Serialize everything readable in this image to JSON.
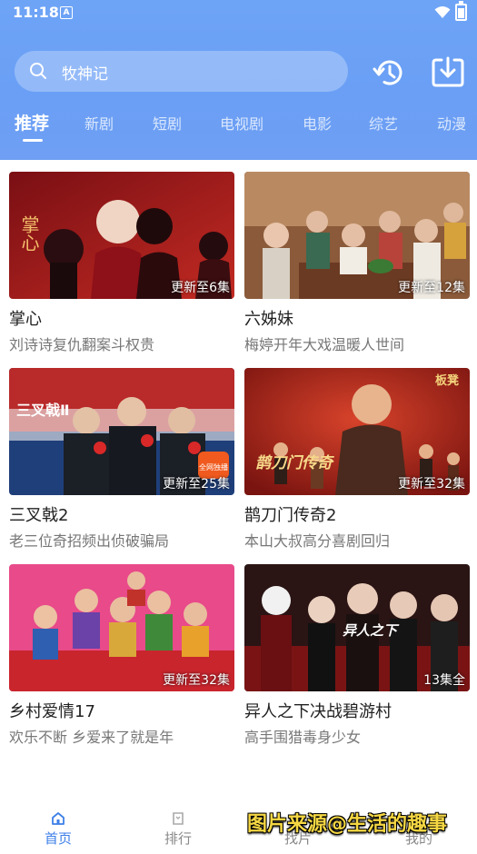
{
  "status_bar": {
    "time": "11:18",
    "indicator": "A"
  },
  "search": {
    "text": "牧神记"
  },
  "header_icons": [
    "history-icon",
    "download-icon"
  ],
  "tabs": [
    {
      "label": "推荐",
      "active": true
    },
    {
      "label": "新剧"
    },
    {
      "label": "短剧"
    },
    {
      "label": "电视剧"
    },
    {
      "label": "电影"
    },
    {
      "label": "综艺"
    },
    {
      "label": "动漫"
    }
  ],
  "cards": [
    {
      "title": "掌心",
      "subtitle": "刘诗诗复仇翻案斗权贵",
      "badge": "更新至6集",
      "poster_text": "掌心"
    },
    {
      "title": "六姊妹",
      "subtitle": "梅婷开年大戏温暖人世间",
      "badge": "更新至12集",
      "poster_text": ""
    },
    {
      "title": "三叉戟2",
      "subtitle": "老三位奇招频出侦破骗局",
      "badge": "更新至25集",
      "poster_text": "三叉戟Ⅱ",
      "poster_tag": "全网独播"
    },
    {
      "title": "鹊刀门传奇2",
      "subtitle": "本山大叔高分喜剧回归",
      "badge": "更新至32集",
      "poster_text": "鹊刀门传奇",
      "poster_tag": "板凳"
    },
    {
      "title": "乡村爱情17",
      "subtitle": "欢乐不断 乡爱来了就是年",
      "badge": "更新至32集",
      "poster_text": ""
    },
    {
      "title": "异人之下决战碧游村",
      "subtitle": "高手围猎毒身少女",
      "badge": "13集全",
      "poster_text": "异人之下"
    }
  ],
  "bottom_nav": [
    {
      "label": "首页",
      "icon": "home-icon",
      "active": true
    },
    {
      "label": "排行",
      "icon": "rank-icon"
    },
    {
      "label": "找片",
      "icon": "find-icon"
    },
    {
      "label": "我的",
      "icon": "profile-icon"
    }
  ],
  "watermark": "图片来源@生活的趣事",
  "colors": {
    "header": "#6ea4f6",
    "accent": "#3d7fe8",
    "watermark": "#f5d743"
  }
}
